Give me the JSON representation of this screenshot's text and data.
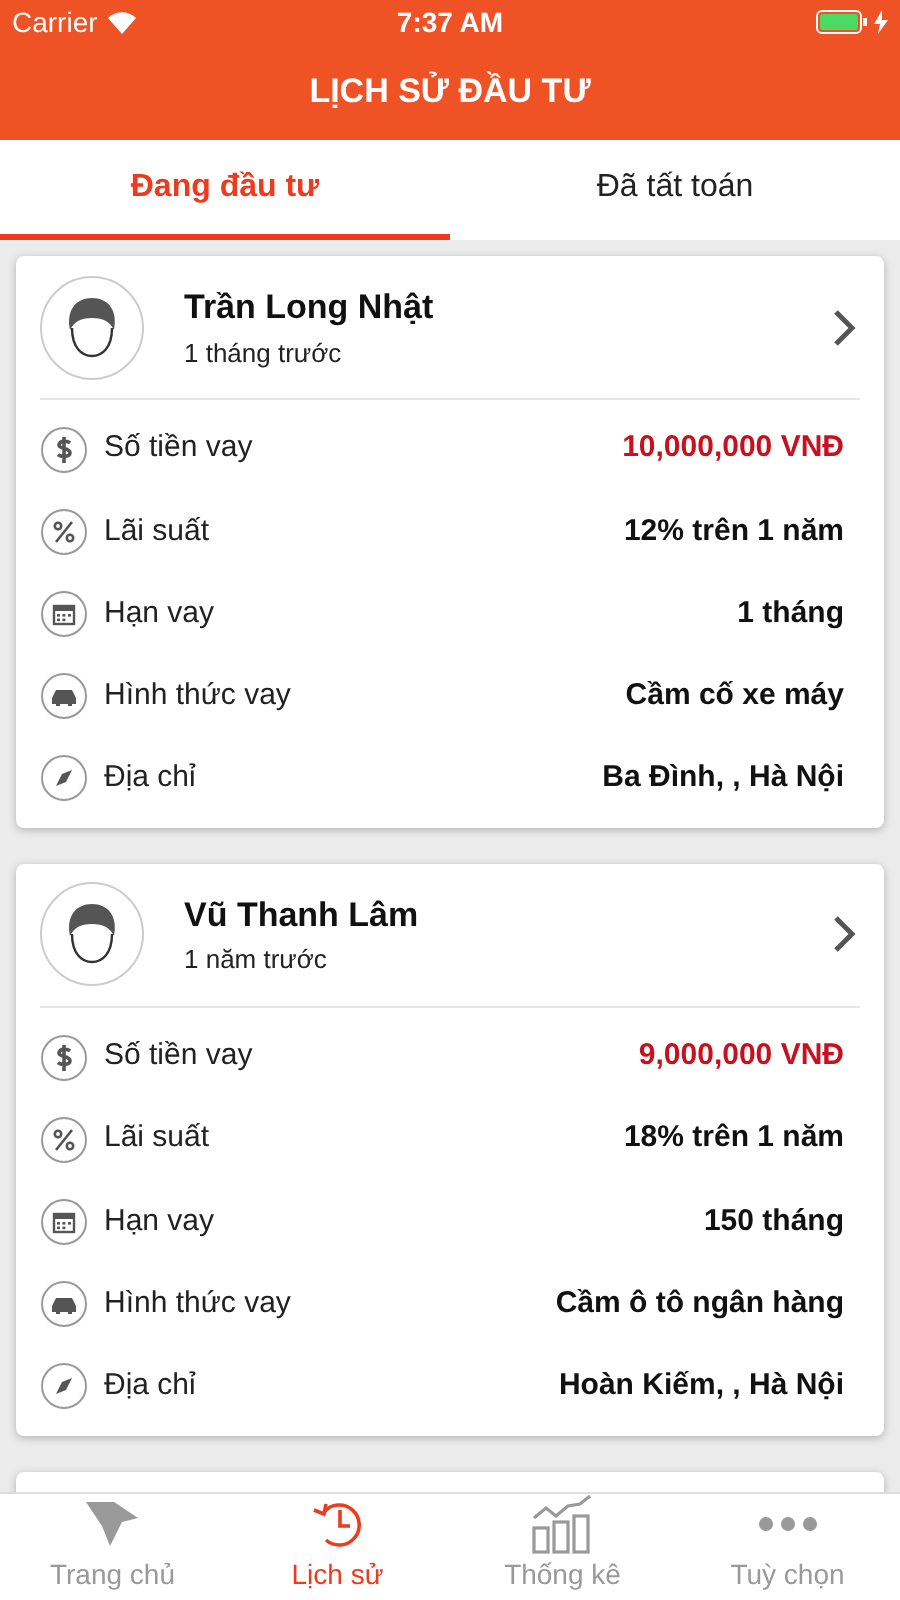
{
  "status_bar": {
    "carrier": "Carrier",
    "time": "7:37 AM"
  },
  "header": {
    "title": "LỊCH SỬ ĐẦU TƯ"
  },
  "tabs": [
    {
      "label": "Đang đầu tư",
      "selected": true
    },
    {
      "label": "Đã tất toán",
      "selected": false
    }
  ],
  "cards": [
    {
      "name": "Trần Long Nhật",
      "time": "1 tháng trước",
      "rows": [
        {
          "label": "Số tiền vay",
          "value": "10,000,000 VNĐ",
          "emphasis": true
        },
        {
          "label": "Lãi suất",
          "value": "12% trên 1 năm",
          "emphasis": false
        },
        {
          "label": "Hạn vay",
          "value": "1 tháng",
          "emphasis": false
        },
        {
          "label": "Hình thức vay",
          "value": "Cầm cố xe máy",
          "emphasis": false
        },
        {
          "label": "Địa chỉ",
          "value": "Ba Đình, , Hà Nội",
          "emphasis": false
        }
      ]
    },
    {
      "name": "Vũ Thanh Lâm",
      "time": "1 năm trước",
      "rows": [
        {
          "label": "Số tiền vay",
          "value": "9,000,000 VNĐ",
          "emphasis": true
        },
        {
          "label": "Lãi suất",
          "value": "18% trên 1 năm",
          "emphasis": false
        },
        {
          "label": "Hạn vay",
          "value": "150 tháng",
          "emphasis": false
        },
        {
          "label": "Hình thức vay",
          "value": "Cầm ô tô ngân hàng",
          "emphasis": false
        },
        {
          "label": "Địa chỉ",
          "value": "Hoàn Kiếm, , Hà Nội",
          "emphasis": false
        }
      ]
    }
  ],
  "tab_bar": [
    {
      "label": "Trang chủ",
      "selected": false
    },
    {
      "label": "Lịch sử",
      "selected": true
    },
    {
      "label": "Thống kê",
      "selected": false
    },
    {
      "label": "Tuỳ chọn",
      "selected": false
    }
  ]
}
